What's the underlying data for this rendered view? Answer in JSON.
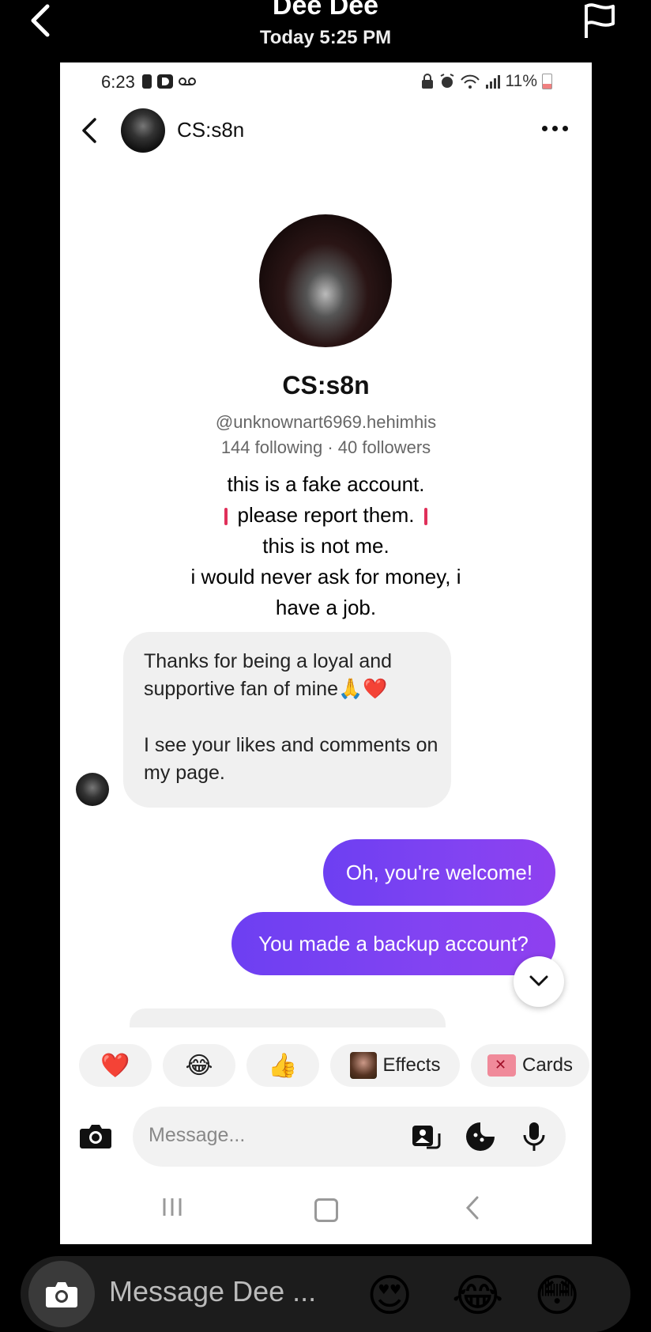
{
  "outer": {
    "title": "Dee Dee",
    "subtitle": "Today 5:25 PM",
    "composer_placeholder": "Message Dee ...",
    "quick_emojis": [
      "😍",
      "😂",
      "😳"
    ]
  },
  "phone": {
    "status": {
      "time": "6:23",
      "battery": "11%"
    },
    "chat_header": {
      "name": "CS:s8n"
    },
    "profile": {
      "name": "CS:s8n",
      "handle": "@unknownart6969.hehimhis",
      "stats": "144 following · 40 followers"
    },
    "caption": {
      "line1": "this is a fake account.",
      "line2": "please report them.",
      "line3": "this is not me.",
      "line4": "i would never ask for money, i",
      "line5": "have a job."
    },
    "messages": {
      "incoming_1": "Thanks for being a loyal and supportive fan of mine🙏❤️",
      "incoming_2": "I see your likes and comments on my page.",
      "outgoing_1": "Oh, you're welcome!",
      "outgoing_2": "You made a backup account?"
    },
    "quick_replies": {
      "heart": "❤️",
      "laugh": "😂",
      "thumbs": "👍",
      "effects": "Effects",
      "cards": "Cards"
    },
    "composer": {
      "placeholder": "Message..."
    }
  },
  "colors": {
    "outgoing_bubble": "#7b42f2",
    "incoming_bubble": "#f0f0f0",
    "background": "#000000"
  }
}
